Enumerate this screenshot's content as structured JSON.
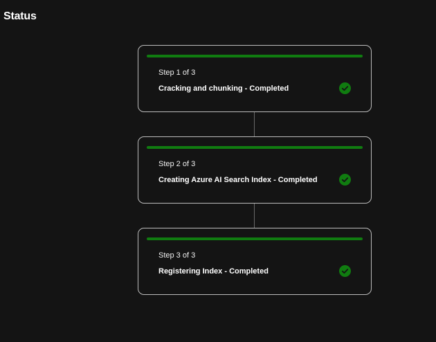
{
  "header": {
    "title": "Status"
  },
  "steps": [
    {
      "number": "Step 1 of 3",
      "status": "Cracking and chunking - Completed",
      "progress": 1.0
    },
    {
      "number": "Step 2 of 3",
      "status": "Creating Azure AI Search Index - Completed",
      "progress": 1.0
    },
    {
      "number": "Step 3 of 3",
      "status": "Registering Index - Completed",
      "progress": 1.0
    }
  ],
  "colors": {
    "background": "#141414",
    "progress": "#107c10",
    "border": "#bdbdbd",
    "connector": "#6a6a6a",
    "check_fill": "#107c10"
  },
  "icons": {
    "completed": "checkmark-circle-icon"
  }
}
